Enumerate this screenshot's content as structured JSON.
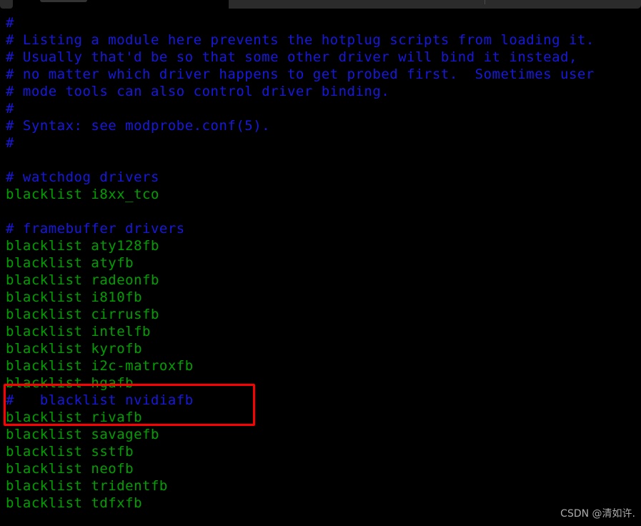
{
  "window": {
    "chrome_label": "",
    "tab_stub_label": ""
  },
  "terminal": {
    "background_color": "#000000",
    "comment_color": "#1818dd",
    "blacklist_color": "#00a000",
    "lines": [
      {
        "text": "#",
        "kind": "comment"
      },
      {
        "text": "# Listing a module here prevents the hotplug scripts from loading it.",
        "kind": "comment"
      },
      {
        "text": "# Usually that'd be so that some other driver will bind it instead,",
        "kind": "comment"
      },
      {
        "text": "# no matter which driver happens to get probed first.  Sometimes user",
        "kind": "comment"
      },
      {
        "text": "# mode tools can also control driver binding.",
        "kind": "comment"
      },
      {
        "text": "#",
        "kind": "comment"
      },
      {
        "text": "# Syntax: see modprobe.conf(5).",
        "kind": "comment"
      },
      {
        "text": "#",
        "kind": "comment"
      },
      {
        "text": "",
        "kind": "blank"
      },
      {
        "text": "# watchdog drivers",
        "kind": "comment"
      },
      {
        "text": "blacklist i8xx_tco",
        "kind": "blacklist"
      },
      {
        "text": "",
        "kind": "blank"
      },
      {
        "text": "# framebuffer drivers",
        "kind": "comment"
      },
      {
        "text": "blacklist aty128fb",
        "kind": "blacklist"
      },
      {
        "text": "blacklist atyfb",
        "kind": "blacklist"
      },
      {
        "text": "blacklist radeonfb",
        "kind": "blacklist"
      },
      {
        "text": "blacklist i810fb",
        "kind": "blacklist"
      },
      {
        "text": "blacklist cirrusfb",
        "kind": "blacklist"
      },
      {
        "text": "blacklist intelfb",
        "kind": "blacklist"
      },
      {
        "text": "blacklist kyrofb",
        "kind": "blacklist"
      },
      {
        "text": "blacklist i2c-matroxfb",
        "kind": "blacklist"
      },
      {
        "text": "blacklist hgafb",
        "kind": "blacklist"
      },
      {
        "text": "#   blacklist nvidiafb",
        "kind": "comment"
      },
      {
        "text": "blacklist rivafb",
        "kind": "blacklist"
      },
      {
        "text": "blacklist savagefb",
        "kind": "blacklist"
      },
      {
        "text": "blacklist sstfb",
        "kind": "blacklist"
      },
      {
        "text": "blacklist neofb",
        "kind": "blacklist"
      },
      {
        "text": "blacklist tridentfb",
        "kind": "blacklist"
      },
      {
        "text": "blacklist tdfxfb",
        "kind": "blacklist"
      }
    ]
  },
  "annotation": {
    "highlight_color": "#ff0000",
    "highlight_label": ""
  },
  "watermark": {
    "text": "CSDN @清如许."
  }
}
